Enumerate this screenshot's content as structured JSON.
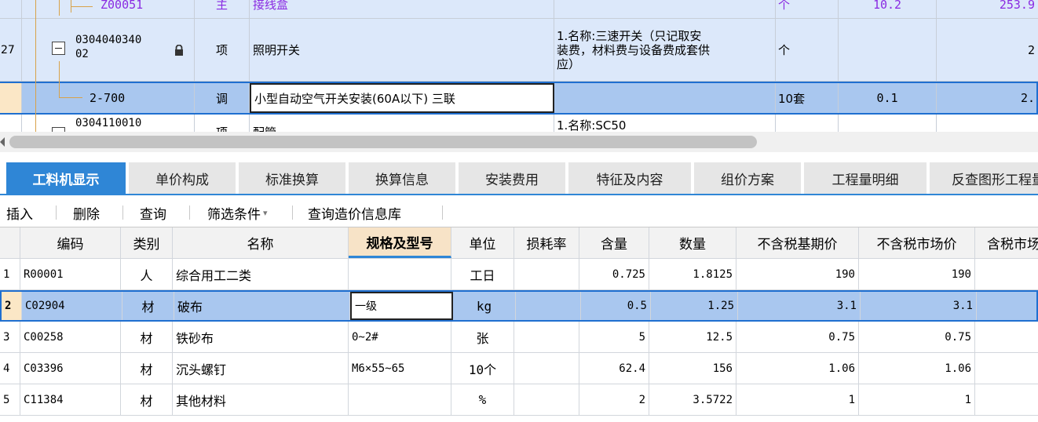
{
  "upper_grid": {
    "rows": [
      {
        "code": "Z00051",
        "type": "主",
        "name": "接线盒",
        "feature": "",
        "unit": "个",
        "qty": "10.2",
        "price": "253.9"
      },
      {
        "seq": "27",
        "code_line1": "0304040340",
        "code_line2": "02",
        "type": "项",
        "name": "照明开关",
        "feature_lines": [
          "1.名称:三速开关（只记取安",
          "装费，材料费与设备费成套供",
          "应）"
        ],
        "unit": "个",
        "qty": "",
        "price": "2"
      },
      {
        "code": "2-700",
        "type": "调",
        "name": "小型自动空气开关安装(60A以下) 三联",
        "feature": "",
        "unit": "10套",
        "qty": "0.1",
        "price": "2."
      },
      {
        "code": "0304110010",
        "type": "项",
        "name": "配管",
        "feature": "1.名称:SC50"
      }
    ]
  },
  "tabs": [
    "工料机显示",
    "单价构成",
    "标准换算",
    "换算信息",
    "安装费用",
    "特征及内容",
    "组价方案",
    "工程量明细",
    "反查图形工程量"
  ],
  "toolbar": {
    "insert": "插入",
    "delete": "删除",
    "query": "查询",
    "filter": "筛选条件",
    "filter_arrow": "▾",
    "price_lib": "查询造价信息库"
  },
  "lower_grid": {
    "headers": [
      "",
      "编码",
      "类别",
      "名称",
      "规格及型号",
      "单位",
      "损耗率",
      "含量",
      "数量",
      "不含税基期价",
      "不含税市场价",
      "含税市场价"
    ],
    "rows": [
      {
        "n": "1",
        "code": "R00001",
        "type": "人",
        "name": "综合用工二类",
        "spec": "",
        "unit": "工日",
        "loss": "",
        "content": "0.725",
        "qty": "1.8125",
        "base": "190",
        "market": "190"
      },
      {
        "n": "2",
        "code": "C02904",
        "type": "材",
        "name": "破布",
        "spec": "一级",
        "unit": "kg",
        "loss": "",
        "content": "0.5",
        "qty": "1.25",
        "base": "3.1",
        "market": "3.1"
      },
      {
        "n": "3",
        "code": "C00258",
        "type": "材",
        "name": "铁砂布",
        "spec": "0~2#",
        "unit": "张",
        "loss": "",
        "content": "5",
        "qty": "12.5",
        "base": "0.75",
        "market": "0.75"
      },
      {
        "n": "4",
        "code": "C03396",
        "type": "材",
        "name": "沉头螺钉",
        "spec": "M6×55~65",
        "unit": "10个",
        "loss": "",
        "content": "62.4",
        "qty": "156",
        "base": "1.06",
        "market": "1.06"
      },
      {
        "n": "5",
        "code": "C11384",
        "type": "材",
        "name": "其他材料",
        "spec": "",
        "unit": "%",
        "loss": "",
        "content": "2",
        "qty": "3.5722",
        "base": "1",
        "market": "1"
      }
    ]
  },
  "colors": {
    "accent": "#2f86d6",
    "selected_row": "#a9c7ef",
    "upper_row": "#dce8fa",
    "upper_text": "#8a2be2",
    "tree": "#d8a24a"
  },
  "icons": {
    "lock": "lock-icon",
    "collapse": "minus-box-icon"
  }
}
